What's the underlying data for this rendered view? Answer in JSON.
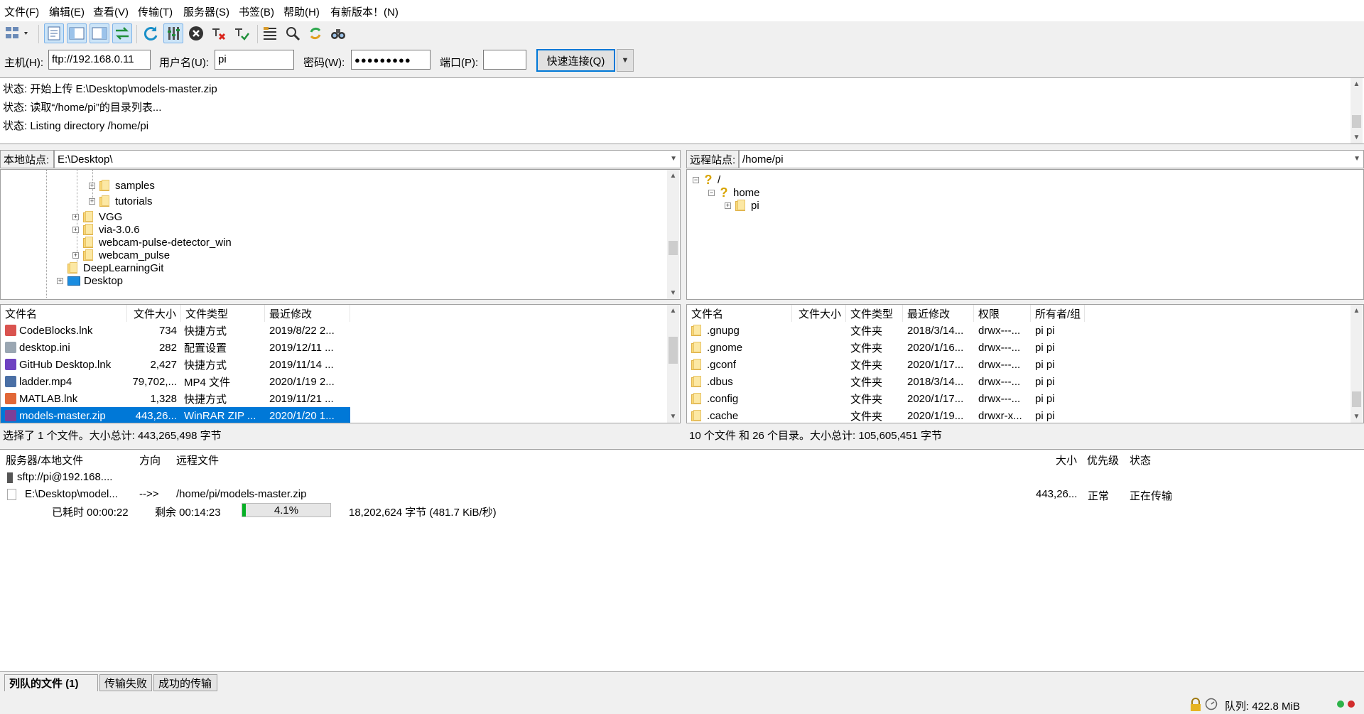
{
  "menu": [
    "文件(F)",
    "编辑(E)",
    "查看(V)",
    "传输(T)",
    "服务器(S)",
    "书签(B)",
    "帮助(H)",
    "有新版本！(N)"
  ],
  "quickconnect": {
    "host_label": "主机(H):",
    "host_value": "ftp://192.168.0.11",
    "user_label": "用户名(U):",
    "user_value": "pi",
    "pass_label": "密码(W):",
    "pass_value": "●●●●●●●●●",
    "port_label": "端口(P):",
    "port_value": "",
    "connect_label": "快速连接(Q)"
  },
  "log": [
    {
      "prefix": "状态:",
      "text": "开始上传 E:\\Desktop\\models-master.zip"
    },
    {
      "prefix": "状态:",
      "text": "读取“/home/pi”的目录列表..."
    },
    {
      "prefix": "状态:",
      "text": "Listing directory /home/pi"
    }
  ],
  "local": {
    "site_label": "本地站点:",
    "path": "E:\\Desktop\\",
    "tree": [
      "samples",
      "tutorials",
      "VGG",
      "via-3.0.6",
      "webcam-pulse-detector_win",
      "webcam_pulse",
      "DeepLearningGit",
      "Desktop"
    ],
    "columns": [
      "文件名",
      "文件大小",
      "文件类型",
      "最近修改"
    ],
    "files": [
      {
        "name": "CodeBlocks.lnk",
        "size": "734",
        "type": "快捷方式",
        "modified": "2019/8/22 2...",
        "icon": "codeblocks-icon",
        "color": "#d9534f"
      },
      {
        "name": "desktop.ini",
        "size": "282",
        "type": "配置设置",
        "modified": "2019/12/11 ...",
        "icon": "config-file-icon",
        "color": "#9aa6b2"
      },
      {
        "name": "GitHub Desktop.lnk",
        "size": "2,427",
        "type": "快捷方式",
        "modified": "2019/11/14 ...",
        "icon": "github-icon",
        "color": "#6f42c1"
      },
      {
        "name": "ladder.mp4",
        "size": "79,702,...",
        "type": "MP4 文件",
        "modified": "2020/1/19 2...",
        "icon": "video-file-icon",
        "color": "#4a6fa5"
      },
      {
        "name": "MATLAB.lnk",
        "size": "1,328",
        "type": "快捷方式",
        "modified": "2019/11/21 ...",
        "icon": "matlab-icon",
        "color": "#e16737"
      },
      {
        "name": "models-master.zip",
        "size": "443,26...",
        "type": "WinRAR ZIP ...",
        "modified": "2020/1/20 1...",
        "icon": "winrar-icon",
        "color": "#7b3f98"
      }
    ],
    "status": "选择了 1 个文件。大小总计: 443,265,498 字节"
  },
  "remote": {
    "site_label": "远程站点:",
    "path": "/home/pi",
    "tree": [
      "/",
      "home",
      "pi"
    ],
    "columns": [
      "文件名",
      "文件大小",
      "文件类型",
      "最近修改",
      "权限",
      "所有者/组"
    ],
    "files": [
      {
        "name": ".gnupg",
        "size": "",
        "type": "文件夹",
        "modified": "2018/3/14...",
        "perm": "drwx---...",
        "owner": "pi pi"
      },
      {
        "name": ".gnome",
        "size": "",
        "type": "文件夹",
        "modified": "2020/1/16...",
        "perm": "drwx---...",
        "owner": "pi pi"
      },
      {
        "name": ".gconf",
        "size": "",
        "type": "文件夹",
        "modified": "2020/1/17...",
        "perm": "drwx---...",
        "owner": "pi pi"
      },
      {
        "name": ".dbus",
        "size": "",
        "type": "文件夹",
        "modified": "2018/3/14...",
        "perm": "drwx---...",
        "owner": "pi pi"
      },
      {
        "name": ".config",
        "size": "",
        "type": "文件夹",
        "modified": "2020/1/17...",
        "perm": "drwx---...",
        "owner": "pi pi"
      },
      {
        "name": ".cache",
        "size": "",
        "type": "文件夹",
        "modified": "2020/1/19...",
        "perm": "drwxr-x...",
        "owner": "pi pi"
      }
    ],
    "status": "10 个文件 和 26 个目录。大小总计: 105,605,451 字节"
  },
  "queue": {
    "columns": [
      "服务器/本地文件",
      "方向",
      "远程文件",
      "大小",
      "优先级",
      "状态"
    ],
    "server": "sftp://pi@192.168....",
    "local_file": "E:\\Desktop\\model...",
    "direction": "-->>",
    "remote_file": "/home/pi/models-master.zip",
    "size": "443,26...",
    "priority": "正常",
    "status": "正在传输",
    "elapsed": "已耗时 00:00:22",
    "remaining": "剩余 00:14:23",
    "progress_percent": 4.1,
    "progress_label": "4.1%",
    "bytes": "18,202,624 字节 (481.7 KiB/秒)"
  },
  "tabs": [
    "列队的文件 (1)",
    "传输失败",
    "成功的传输"
  ],
  "statusbar": {
    "queue": "队列: 422.8 MiB"
  }
}
